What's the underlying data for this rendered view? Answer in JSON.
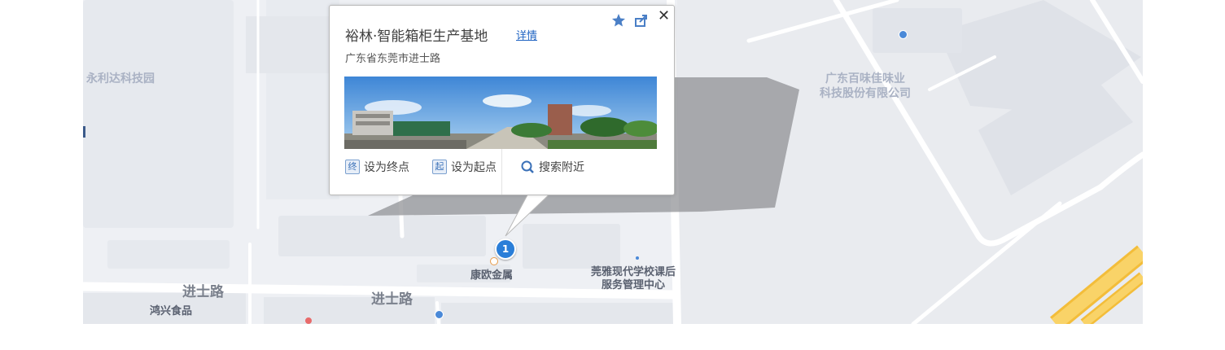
{
  "map": {
    "roads": [
      {
        "label": "进士路"
      },
      {
        "label": "进士路"
      }
    ],
    "pois": [
      {
        "label": "康欧金属"
      },
      {
        "label": "莞雅现代学校课后\n服务管理中心"
      },
      {
        "label": "鸿兴食品"
      }
    ],
    "areas": [
      {
        "label": "永利达科技园"
      },
      {
        "label": "广东百味佳味业\n科技股份有限公司"
      }
    ],
    "marker": {
      "number": "1"
    },
    "colors": {
      "background": "#eef0f4",
      "road": "#ffffff",
      "highway": "#f7c948",
      "marker": "#2a7ed8"
    }
  },
  "popup": {
    "title": "裕林·智能箱柜生产基地",
    "details_link": "详情",
    "address": "广东省东莞市进士路",
    "icons": [
      "star-icon",
      "share-icon",
      "close-icon"
    ],
    "close_label": "✕",
    "actions": [
      {
        "icon": "终",
        "label": "设为终点"
      },
      {
        "icon": "起",
        "label": "设为起点"
      },
      {
        "icon": "search-icon",
        "label": "搜索附近"
      }
    ]
  }
}
